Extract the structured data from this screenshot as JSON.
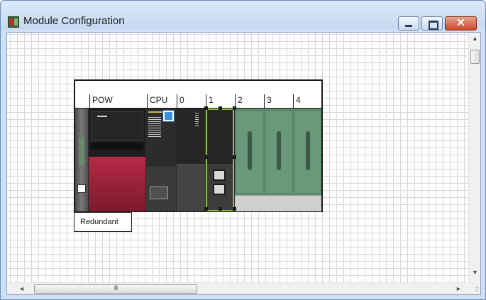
{
  "window": {
    "title": "Module Configuration",
    "close_glyph": "✕",
    "icons": [
      "module-config-app-icon",
      "minimize-icon",
      "maximize-icon",
      "close-icon"
    ]
  },
  "slots": {
    "labels": [
      "POW",
      "CPU",
      "0",
      "1",
      "2",
      "3",
      "4"
    ]
  },
  "modules": [
    {
      "slot": "side",
      "kind": "base-extension"
    },
    {
      "slot": "POW",
      "kind": "power-supply",
      "accent": "#b52a45"
    },
    {
      "slot": "CPU",
      "kind": "cpu",
      "selected": true,
      "selection_color": "#3a8ee6"
    },
    {
      "slot": "0",
      "kind": "io-module"
    },
    {
      "slot": "1",
      "kind": "network-module",
      "highlight_color": "#8fbf3f"
    },
    {
      "slot": "2",
      "kind": "empty",
      "color": "#5b8a6a"
    },
    {
      "slot": "3",
      "kind": "empty",
      "color": "#5b8a6a"
    },
    {
      "slot": "4",
      "kind": "empty",
      "color": "#5b8a6a"
    }
  ],
  "tag": {
    "label": "Redundant"
  },
  "scrollbars": {
    "up_glyph": "▲",
    "down_glyph": "▼",
    "left_glyph": "◄",
    "right_glyph": "►",
    "thumb_grip": "III",
    "resize_grip": "⠿"
  }
}
